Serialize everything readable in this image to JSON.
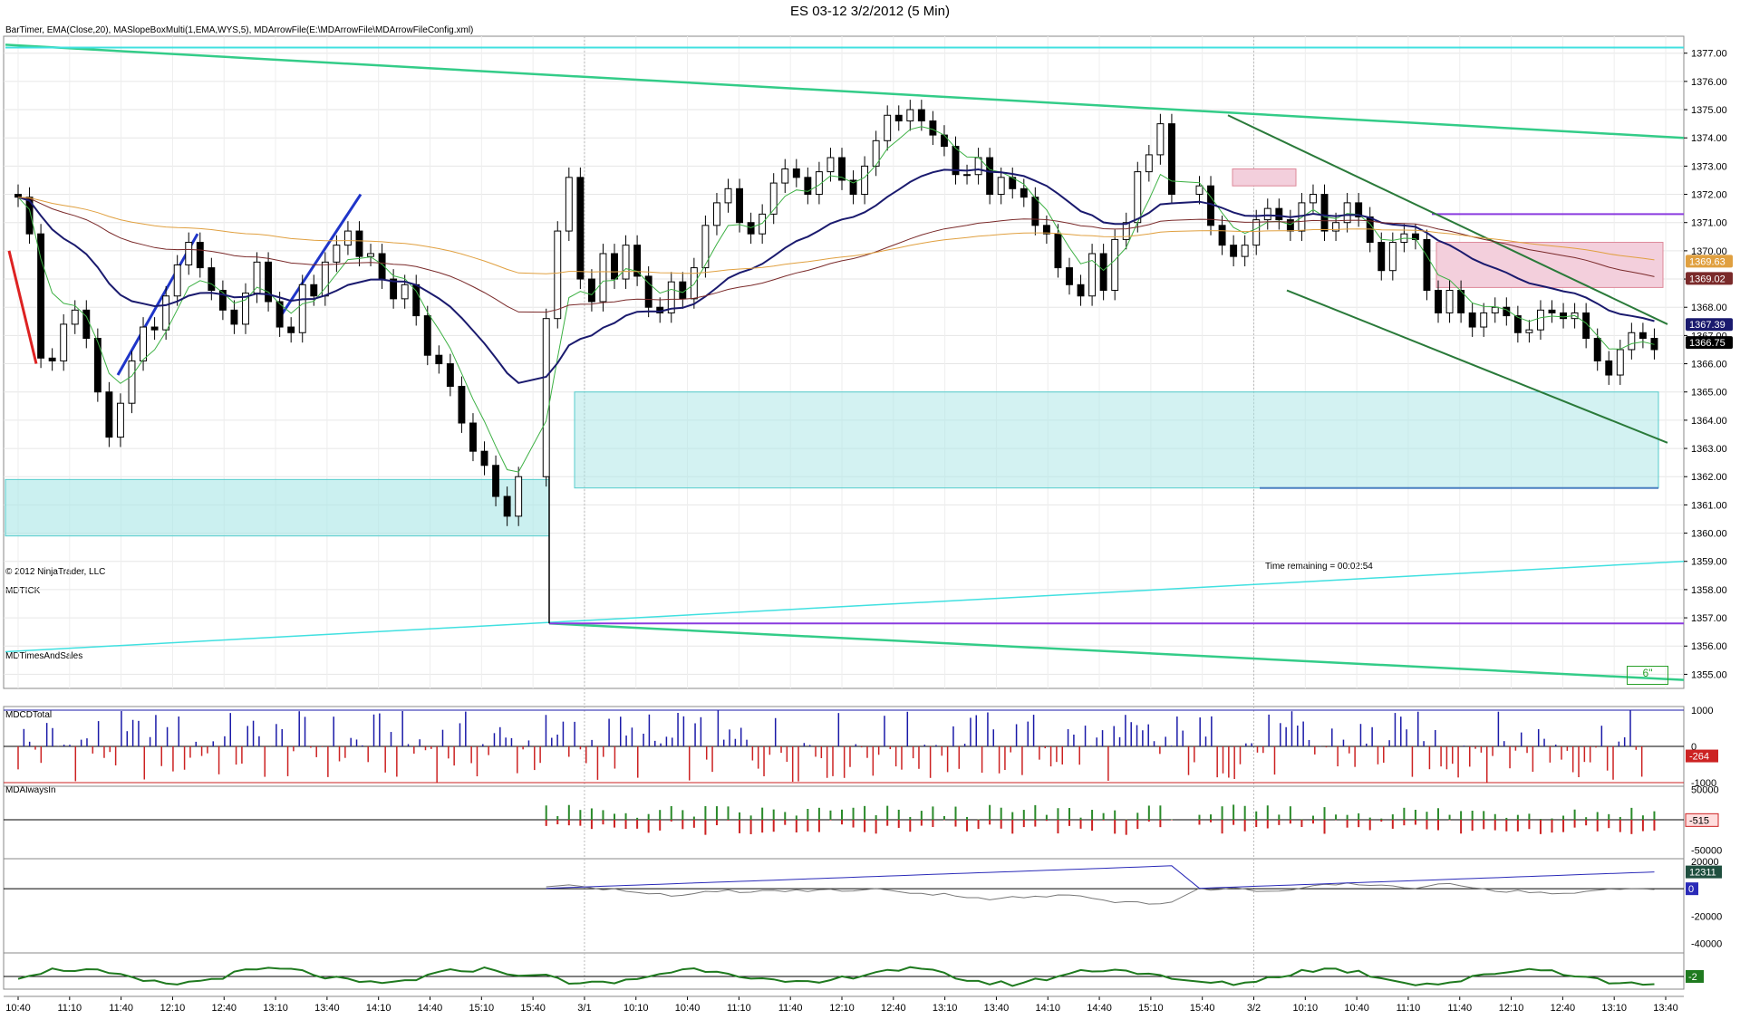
{
  "window": {
    "title": "ES 03-12  3/2/2012 (5 Min)",
    "indicator_caption": "BarTimer, EMA(Close,20), MASlopeBoxMulti(1,EMA,WYS,5), MDArrowFile(E:\\MDArrowFile\\MDArrowFileConfig.xml)",
    "copyright": "© 2012 NinjaTrader, LLC",
    "time_remaining": "Time remaining = 00:02:54",
    "corner_box_label": "6\""
  },
  "colors": {
    "up_bar": "#ffffff",
    "down_bar": "#000000",
    "ema20": "#1a1a6e",
    "ema_brown": "#7a2a2a",
    "ema_orange": "#e0a040",
    "ema_green": "#3cb043",
    "cyan_box": "#a8e6e6",
    "cyan_line": "#40e0e0",
    "green_channel": "#33cc88",
    "blue_trend": "#1f35c9",
    "red_line": "#dd2222",
    "purple_line": "#8a3adf",
    "pink_box": "#f3cfdc",
    "tick_blue": "#1a1aa8",
    "tick_red": "#cc2222",
    "vol_green": "#2a8a2a"
  },
  "chart_data": [
    {
      "type": "candlestick",
      "name": "ES 03-12 (5 Min)",
      "ylim": [
        1354.5,
        1377.6
      ],
      "y_ticks": [
        "1377.00",
        "1376.00",
        "1375.00",
        "1374.00",
        "1373.00",
        "1372.00",
        "1371.00",
        "1370.00",
        "1369.00",
        "1368.00",
        "1367.00",
        "1366.00",
        "1365.00",
        "1364.00",
        "1363.00",
        "1362.00",
        "1361.00",
        "1360.00",
        "1359.00",
        "1358.00",
        "1357.00",
        "1356.00",
        "1355.00"
      ],
      "price_labels": [
        {
          "text": "1369.63",
          "value": 1369.63,
          "bg": "#e0a040"
        },
        {
          "text": "1369.02",
          "value": 1369.02,
          "bg": "#7a2a2a"
        },
        {
          "text": "1367.39",
          "value": 1367.39,
          "bg": "#1a1a6e"
        },
        {
          "text": "1366.75",
          "value": 1366.75,
          "bg": "#000000"
        }
      ],
      "x_labels": [
        "10:40",
        "11:10",
        "11:40",
        "12:10",
        "12:40",
        "13:10",
        "13:40",
        "14:10",
        "14:40",
        "15:10",
        "15:40",
        "3/1",
        "10:10",
        "10:40",
        "11:10",
        "11:40",
        "12:10",
        "12:40",
        "13:10",
        "13:40",
        "14:10",
        "14:40",
        "15:10",
        "15:40",
        "3/2",
        "10:10",
        "10:40",
        "11:10",
        "11:40",
        "12:10",
        "12:40",
        "13:10",
        "13:40"
      ],
      "close": [
        1371.9,
        1370.6,
        1366.2,
        1366.1,
        1367.4,
        1367.9,
        1366.9,
        1365.0,
        1363.4,
        1364.6,
        1366.1,
        1367.3,
        1367.2,
        1368.4,
        1369.5,
        1370.3,
        1369.4,
        1368.6,
        1367.9,
        1367.4,
        1368.5,
        1369.6,
        1368.2,
        1367.3,
        1367.1,
        1368.8,
        1368.4,
        1369.6,
        1370.2,
        1370.7,
        1369.8,
        1369.9,
        1369.0,
        1368.3,
        1368.8,
        1367.7,
        1366.3,
        1366.0,
        1365.2,
        1363.9,
        1362.9,
        1362.4,
        1361.3,
        1360.6,
        1362.0,
        1367.6,
        1370.7,
        1372.6,
        1369.0,
        1368.2,
        1369.9,
        1369.0,
        1370.2,
        1369.1,
        1368.0,
        1367.8,
        1368.9,
        1368.3,
        1369.4,
        1370.9,
        1371.7,
        1372.2,
        1371.0,
        1370.6,
        1371.3,
        1372.4,
        1372.9,
        1372.6,
        1372.0,
        1372.8,
        1373.3,
        1372.5,
        1372.0,
        1373.0,
        1373.9,
        1374.8,
        1374.6,
        1375.0,
        1374.6,
        1374.1,
        1373.7,
        1372.7,
        1372.7,
        1373.3,
        1372.0,
        1372.6,
        1372.2,
        1371.9,
        1370.9,
        1370.6,
        1369.4,
        1368.8,
        1368.4,
        1369.9,
        1368.6,
        1370.4,
        1371.0,
        1372.8,
        1373.4,
        1374.5,
        1372.0,
        1372.3,
        1370.9,
        1370.2,
        1369.8,
        1370.2,
        1371.1,
        1371.5,
        1371.1,
        1370.7,
        1371.7,
        1372.0,
        1370.7,
        1371.0,
        1371.7,
        1371.2,
        1370.3,
        1369.3,
        1370.3,
        1370.6,
        1370.4,
        1368.6,
        1367.8,
        1368.6,
        1367.8,
        1367.3,
        1367.8,
        1368.0,
        1367.7,
        1367.1,
        1367.2,
        1367.9,
        1367.8,
        1367.6,
        1367.8,
        1366.9,
        1366.1,
        1365.6,
        1366.5,
        1367.1,
        1366.9,
        1366.5
      ],
      "open": [
        1372.0,
        1371.9,
        1370.6,
        1366.2,
        1366.1,
        1367.4,
        1367.9,
        1366.9,
        1365.0,
        1363.4,
        1364.6,
        1366.1,
        1367.3,
        1367.2,
        1368.4,
        1369.5,
        1370.3,
        1369.4,
        1368.6,
        1367.9,
        1367.4,
        1368.5,
        1369.6,
        1368.2,
        1367.3,
        1367.1,
        1368.8,
        1368.4,
        1369.6,
        1370.2,
        1370.7,
        1369.8,
        1369.9,
        1369.0,
        1368.3,
        1368.8,
        1367.7,
        1366.3,
        1366.0,
        1365.2,
        1363.9,
        1362.9,
        1362.4,
        1361.3,
        1360.6,
        1362.0,
        1367.6,
        1370.7,
        1372.6,
        1369.0,
        1368.2,
        1369.9,
        1369.0,
        1370.2,
        1369.1,
        1368.0,
        1367.8,
        1368.9,
        1368.3,
        1369.4,
        1370.9,
        1371.7,
        1372.2,
        1371.0,
        1370.6,
        1371.3,
        1372.4,
        1372.9,
        1372.6,
        1372.0,
        1372.8,
        1373.3,
        1372.5,
        1372.0,
        1373.0,
        1373.9,
        1374.8,
        1374.6,
        1375.0,
        1374.6,
        1374.1,
        1373.7,
        1372.7,
        1372.7,
        1373.3,
        1372.0,
        1372.6,
        1372.2,
        1371.9,
        1370.9,
        1370.6,
        1369.4,
        1368.8,
        1368.4,
        1369.9,
        1368.6,
        1370.4,
        1371.0,
        1372.8,
        1373.4,
        1374.5,
        1372.0,
        1372.3,
        1370.9,
        1370.2,
        1369.8,
        1370.2,
        1371.1,
        1371.5,
        1371.1,
        1370.7,
        1371.7,
        1372.0,
        1370.7,
        1371.0,
        1371.7,
        1371.2,
        1370.3,
        1369.3,
        1370.3,
        1370.6,
        1370.4,
        1368.6,
        1367.8,
        1368.6,
        1367.8,
        1367.3,
        1367.8,
        1368.0,
        1367.7,
        1367.1,
        1367.2,
        1367.9,
        1367.8,
        1367.6,
        1367.8,
        1366.9,
        1366.1,
        1365.6,
        1366.5,
        1367.1,
        1366.9
      ]
    },
    {
      "type": "bar",
      "name": "MDTICK",
      "ylim": [
        -1100,
        1100
      ],
      "y_ticks": [
        "1000",
        "0",
        "-1000"
      ],
      "last_value": "-264"
    },
    {
      "type": "bar",
      "name": "MDTimesAndSales",
      "ylim": [
        -60000,
        60000
      ],
      "y_ticks": [
        "50000",
        "0",
        "-50000"
      ],
      "last_value": "-515"
    },
    {
      "type": "line",
      "name": "MDCDTotal",
      "ylim": [
        -47000,
        22000
      ],
      "y_ticks": [
        "20000",
        "0",
        "-20000",
        "-40000"
      ],
      "last_value": "12311",
      "last_value_2": "0"
    },
    {
      "type": "line",
      "name": "MDAlwaysIn",
      "last_value": "-2"
    }
  ]
}
